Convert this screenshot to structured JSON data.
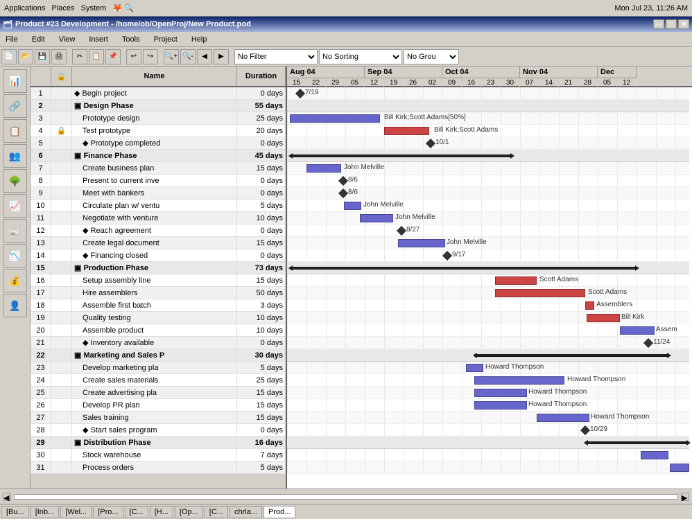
{
  "os_bar": {
    "left": "Applications  Places  System",
    "right": "Mon Jul 23, 11:26 AM"
  },
  "title_bar": {
    "title": "Product #23 Development - /home/ob/OpenProj/New Product.pod",
    "min": "─",
    "max": "□",
    "close": "✕"
  },
  "menu": {
    "items": [
      "File",
      "Edit",
      "View",
      "Insert",
      "Tools",
      "Project",
      "Help"
    ]
  },
  "toolbar": {
    "filter_placeholder": "No Filter",
    "sort_placeholder": "No Sorting",
    "group_placeholder": "No Grou"
  },
  "table": {
    "headers": [
      "",
      "",
      "Name",
      "Duration"
    ],
    "rows": [
      {
        "id": 1,
        "level": 0,
        "name": "Begin project",
        "duration": "0 days",
        "type": "milestone"
      },
      {
        "id": 2,
        "level": 0,
        "name": "Design Phase",
        "duration": "55 days",
        "type": "phase"
      },
      {
        "id": 3,
        "level": 1,
        "name": "Prototype design",
        "duration": "25 days",
        "type": "task"
      },
      {
        "id": 4,
        "level": 1,
        "name": "Test prototype",
        "duration": "20 days",
        "type": "task"
      },
      {
        "id": 5,
        "level": 1,
        "name": "Prototype completed",
        "duration": "0 days",
        "type": "milestone"
      },
      {
        "id": 6,
        "level": 0,
        "name": "Finance Phase",
        "duration": "45 days",
        "type": "phase"
      },
      {
        "id": 7,
        "level": 1,
        "name": "Create business plan",
        "duration": "15 days",
        "type": "task"
      },
      {
        "id": 8,
        "level": 1,
        "name": "Present to current inve",
        "duration": "0 days",
        "type": "task"
      },
      {
        "id": 9,
        "level": 1,
        "name": "Meet with bankers",
        "duration": "0 days",
        "type": "task"
      },
      {
        "id": 10,
        "level": 1,
        "name": "Circulate plan w/ ventu",
        "duration": "5 days",
        "type": "task"
      },
      {
        "id": 11,
        "level": 1,
        "name": "Negotiate with venture",
        "duration": "10 days",
        "type": "task"
      },
      {
        "id": 12,
        "level": 1,
        "name": "Reach agreement",
        "duration": "0 days",
        "type": "milestone"
      },
      {
        "id": 13,
        "level": 1,
        "name": "Create legal document",
        "duration": "15 days",
        "type": "task"
      },
      {
        "id": 14,
        "level": 1,
        "name": "Financing closed",
        "duration": "0 days",
        "type": "milestone"
      },
      {
        "id": 15,
        "level": 0,
        "name": "Production Phase",
        "duration": "73 days",
        "type": "phase"
      },
      {
        "id": 16,
        "level": 1,
        "name": "Setup assembly line",
        "duration": "15 days",
        "type": "task"
      },
      {
        "id": 17,
        "level": 1,
        "name": "Hire assemblers",
        "duration": "50 days",
        "type": "task"
      },
      {
        "id": 18,
        "level": 1,
        "name": "Assemble first batch",
        "duration": "3 days",
        "type": "task"
      },
      {
        "id": 19,
        "level": 1,
        "name": "Quality testing",
        "duration": "10 days",
        "type": "task"
      },
      {
        "id": 20,
        "level": 1,
        "name": "Assemble product",
        "duration": "10 days",
        "type": "task"
      },
      {
        "id": 21,
        "level": 1,
        "name": "Inventory available",
        "duration": "0 days",
        "type": "milestone"
      },
      {
        "id": 22,
        "level": 0,
        "name": "Marketing and Sales P",
        "duration": "30 days",
        "type": "phase"
      },
      {
        "id": 23,
        "level": 1,
        "name": "Develop marketing pla",
        "duration": "5 days",
        "type": "task"
      },
      {
        "id": 24,
        "level": 1,
        "name": "Create sales materials",
        "duration": "25 days",
        "type": "task"
      },
      {
        "id": 25,
        "level": 1,
        "name": "Create advertising pla",
        "duration": "15 days",
        "type": "task"
      },
      {
        "id": 26,
        "level": 1,
        "name": "Develop PR plan",
        "duration": "15 days",
        "type": "task"
      },
      {
        "id": 27,
        "level": 1,
        "name": "Sales training",
        "duration": "15 days",
        "type": "task"
      },
      {
        "id": 28,
        "level": 1,
        "name": "Start sales program",
        "duration": "0 days",
        "type": "milestone"
      },
      {
        "id": 29,
        "level": 0,
        "name": "Distribution Phase",
        "duration": "16 days",
        "type": "phase"
      },
      {
        "id": 30,
        "level": 1,
        "name": "Stock warehouse",
        "duration": "7 days",
        "type": "task"
      },
      {
        "id": 31,
        "level": 1,
        "name": "Process orders",
        "duration": "5 days",
        "type": "task"
      }
    ]
  },
  "gantt": {
    "months": [
      {
        "label": "Aug 04",
        "weeks": [
          "15",
          "22",
          "29",
          "05"
        ]
      },
      {
        "label": "Sep 04",
        "weeks": [
          "12",
          "19",
          "26",
          "02"
        ]
      },
      {
        "label": "Oct 04",
        "weeks": [
          "09",
          "16",
          "23",
          "30"
        ]
      },
      {
        "label": "Nov 04",
        "weeks": [
          "07",
          "14",
          "21",
          "28"
        ]
      },
      {
        "label": "Dec",
        "weeks": [
          "05",
          "12"
        ]
      }
    ]
  },
  "taskbar": {
    "items": [
      "[Bu...",
      "[Inb...",
      "[Wel...",
      "[Pro...",
      "[C...",
      "[H...",
      "[Op...",
      "[C...",
      "chrla...",
      "Prod..."
    ]
  }
}
